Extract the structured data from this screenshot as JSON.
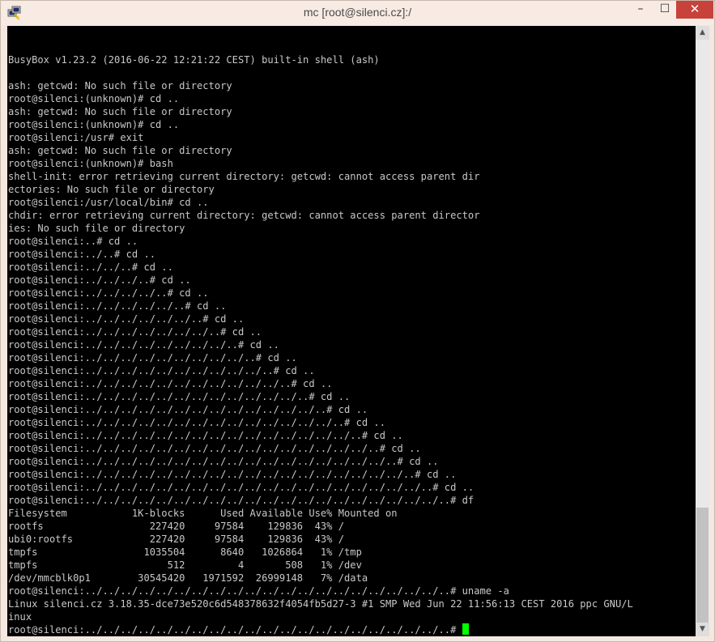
{
  "window": {
    "title": "mc [root@silenci.cz]:/",
    "app_icon": "putty-icon",
    "controls": {
      "minimize": "–",
      "maximize": "☐",
      "close": "✕"
    },
    "accent_close": "#c7423b"
  },
  "terminal": {
    "background": "#000000",
    "foreground": "#c8c8c8",
    "cursor_color": "#00ff00",
    "lines": [
      "BusyBox v1.23.2 (2016-06-22 12:21:22 CEST) built-in shell (ash)",
      "",
      "ash: getcwd: No such file or directory",
      "root@silenci:(unknown)# cd ..",
      "ash: getcwd: No such file or directory",
      "root@silenci:(unknown)# cd ..",
      "root@silenci:/usr# exit",
      "ash: getcwd: No such file or directory",
      "root@silenci:(unknown)# bash",
      "shell-init: error retrieving current directory: getcwd: cannot access parent dir",
      "ectories: No such file or directory",
      "root@silenci:/usr/local/bin# cd ..",
      "chdir: error retrieving current directory: getcwd: cannot access parent director",
      "ies: No such file or directory",
      "root@silenci:..# cd ..",
      "root@silenci:../..# cd ..",
      "root@silenci:../../..# cd ..",
      "root@silenci:../../../..# cd ..",
      "root@silenci:../../../../..# cd ..",
      "root@silenci:../../../../../..# cd ..",
      "root@silenci:../../../../../../..# cd ..",
      "root@silenci:../../../../../../../..# cd ..",
      "root@silenci:../../../../../../../../..# cd ..",
      "root@silenci:../../../../../../../../../..# cd ..",
      "root@silenci:../../../../../../../../../../..# cd ..",
      "root@silenci:../../../../../../../../../../../..# cd ..",
      "root@silenci:../../../../../../../../../../../../..# cd ..",
      "root@silenci:../../../../../../../../../../../../../..# cd ..",
      "root@silenci:../../../../../../../../../../../../../../..# cd ..",
      "root@silenci:../../../../../../../../../../../../../../../..# cd ..",
      "root@silenci:../../../../../../../../../../../../../../../../..# cd ..",
      "root@silenci:../../../../../../../../../../../../../../../../../..# cd ..",
      "root@silenci:../../../../../../../../../../../../../../../../../../..# cd ..",
      "root@silenci:../../../../../../../../../../../../../../../../../../../..# cd ..",
      "root@silenci:../../../../../../../../../../../../../../../../../../../../..# df",
      "Filesystem           1K-blocks      Used Available Use% Mounted on",
      "rootfs                  227420     97584    129836  43% /",
      "ubi0:rootfs             227420     97584    129836  43% /",
      "tmpfs                  1035504      8640   1026864   1% /tmp",
      "tmpfs                      512         4       508   1% /dev",
      "/dev/mmcblk0p1        30545420   1971592  26999148   7% /data",
      "root@silenci:../../../../../../../../../../../../../../../../../../../../..# uname -a",
      "Linux silenci.cz 3.18.35-dce73e520c6d548378632f4054fb5d27-3 #1 SMP Wed Jun 22 11:56:13 CEST 2016 ppc GNU/L",
      "inux"
    ],
    "prompt": "root@silenci:../../../../../../../../../../../../../../../../../../../../..# "
  },
  "scrollbar": {
    "up_icon": "▲",
    "down_icon": "▼"
  }
}
